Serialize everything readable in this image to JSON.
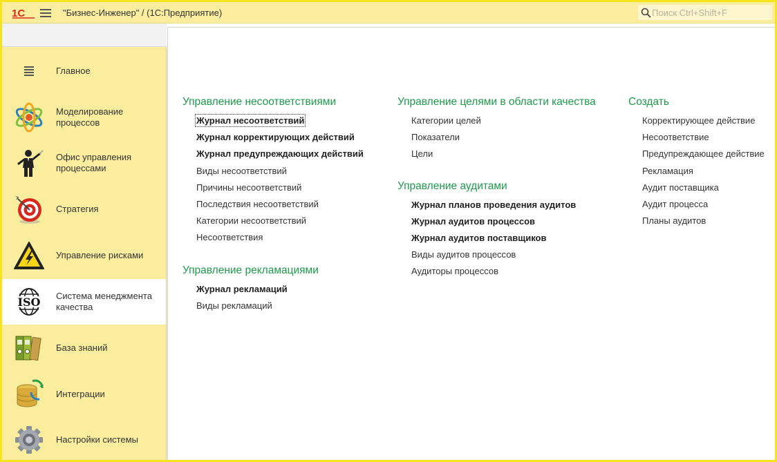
{
  "titlebar": {
    "logo_text": "1С",
    "title": "\"Бизнес-Инженер\" / (1С:Предприятие)",
    "search_placeholder": "Поиск Ctrl+Shift+F"
  },
  "sidebar": {
    "items": [
      {
        "label": "Главное",
        "icon": "hamburger-list-icon"
      },
      {
        "label": "Моделирование процессов",
        "icon": "atom-icon"
      },
      {
        "label": "Офис управления процессами",
        "icon": "conductor-icon"
      },
      {
        "label": "Стратегия",
        "icon": "target-dart-icon"
      },
      {
        "label": "Управление рисками",
        "icon": "warning-high-voltage-icon"
      },
      {
        "label": "Система менеджмента качества",
        "icon": "iso-icon"
      },
      {
        "label": "База знаний",
        "icon": "binders-icon"
      },
      {
        "label": "Интеграции",
        "icon": "database-sync-icon"
      },
      {
        "label": "Настройки системы",
        "icon": "gear-icon"
      }
    ],
    "active_index": 5
  },
  "main": {
    "columns": [
      {
        "groups": [
          {
            "title": "Управление несоответствиями",
            "links": [
              {
                "label": "Журнал несоответствий",
                "bold": true
              },
              {
                "label": "Журнал корректирующих действий",
                "bold": true
              },
              {
                "label": "Журнал предупреждающих действий",
                "bold": true
              },
              {
                "label": "Виды несоответствий",
                "bold": false
              },
              {
                "label": "Причины несоответствий",
                "bold": false
              },
              {
                "label": "Последствия несоответствий",
                "bold": false
              },
              {
                "label": "Категории несоответствий",
                "bold": false
              },
              {
                "label": "Несоответствия",
                "bold": false
              }
            ]
          },
          {
            "title": "Управление рекламациями",
            "links": [
              {
                "label": "Журнал рекламаций",
                "bold": true
              },
              {
                "label": "Виды рекламаций",
                "bold": false
              }
            ]
          }
        ]
      },
      {
        "groups": [
          {
            "title": "Управление целями в области качества",
            "links": [
              {
                "label": "Категории целей",
                "bold": false
              },
              {
                "label": "Показатели",
                "bold": false
              },
              {
                "label": "Цели",
                "bold": false
              }
            ]
          },
          {
            "title": "Управление аудитами",
            "links": [
              {
                "label": "Журнал планов проведения аудитов",
                "bold": true
              },
              {
                "label": "Журнал аудитов процессов",
                "bold": true
              },
              {
                "label": "Журнал аудитов поставщиков",
                "bold": true
              },
              {
                "label": "Виды аудитов процессов",
                "bold": false
              },
              {
                "label": "Аудиторы процессов",
                "bold": false
              }
            ]
          }
        ]
      },
      {
        "groups": [
          {
            "title": "Создать",
            "links": [
              {
                "label": "Корректирующее действие",
                "bold": false
              },
              {
                "label": "Несоответствие",
                "bold": false
              },
              {
                "label": "Предупреждающее действие",
                "bold": false
              },
              {
                "label": "Рекламация",
                "bold": false
              },
              {
                "label": "Аудит поставщика",
                "bold": false
              },
              {
                "label": "Аудит процесса",
                "bold": false
              },
              {
                "label": "Планы аудитов",
                "bold": false
              }
            ]
          }
        ]
      }
    ]
  },
  "colors": {
    "accent_yellow": "#fbed9e",
    "frame_yellow": "#f7e31a",
    "group_title_green": "#1d9b4b",
    "logo_red": "#d7281e"
  }
}
